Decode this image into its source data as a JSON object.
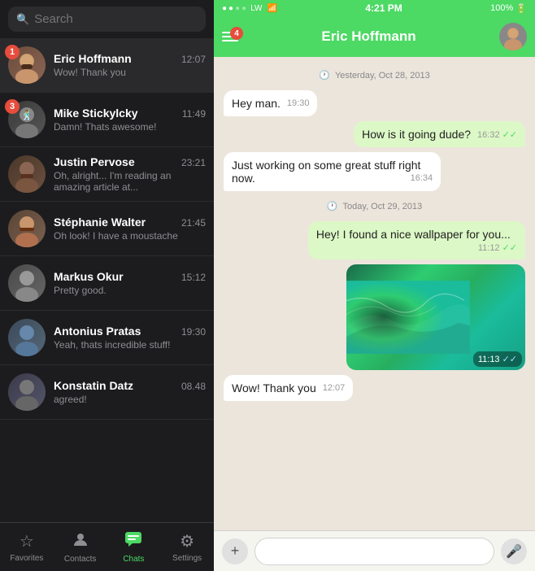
{
  "statusBar": {
    "carrier": "LW",
    "time": "4:21 PM",
    "battery": "100%",
    "signal": "●●○○"
  },
  "searchBar": {
    "placeholder": "Search"
  },
  "chats": [
    {
      "id": "eric",
      "name": "Eric Hoffmann",
      "time": "12:07",
      "preview": "Wow! Thank you",
      "badge": 1,
      "avatarClass": "av-eric",
      "avatarEmoji": "👤",
      "active": true
    },
    {
      "id": "mike",
      "name": "Mike Stickylcky",
      "time": "11:49",
      "preview": "Damn! Thats awesome!",
      "badge": 3,
      "avatarClass": "av-mike",
      "avatarEmoji": "👤"
    },
    {
      "id": "justin",
      "name": "Justin Pervose",
      "time": "23:21",
      "preview": "Oh, alright... I'm reading an amazing article at...",
      "badge": 0,
      "avatarClass": "av-justin",
      "avatarEmoji": "👤"
    },
    {
      "id": "stephanie",
      "name": "Stéphanie Walter",
      "time": "21:45",
      "preview": "Oh look! I have a moustache",
      "badge": 0,
      "avatarClass": "av-stephanie",
      "avatarEmoji": "👤"
    },
    {
      "id": "markus",
      "name": "Markus Okur",
      "time": "15:12",
      "preview": "Pretty good.",
      "badge": 0,
      "avatarClass": "av-markus",
      "avatarEmoji": "👤"
    },
    {
      "id": "antonius",
      "name": "Antonius Pratas",
      "time": "19:30",
      "preview": "Yeah, thats incredible stuff!",
      "badge": 0,
      "avatarClass": "av-antonius",
      "avatarEmoji": "👤"
    },
    {
      "id": "konstatin",
      "name": "Konstatin Datz",
      "time": "08.48",
      "preview": "agreed!",
      "badge": 0,
      "avatarClass": "av-konstatin",
      "avatarEmoji": "👤"
    }
  ],
  "tabBar": {
    "items": [
      {
        "id": "favorites",
        "label": "Favorites",
        "icon": "☆"
      },
      {
        "id": "contacts",
        "label": "Contacts",
        "icon": "👤"
      },
      {
        "id": "chats",
        "label": "Chats",
        "icon": "💬",
        "active": true
      },
      {
        "id": "settings",
        "label": "Settings",
        "icon": "⚙"
      }
    ]
  },
  "chatHeader": {
    "title": "Eric Hoffmann",
    "badgeCount": "4"
  },
  "messages": [
    {
      "type": "date",
      "text": "Yesterday, Oct 28, 2013"
    },
    {
      "type": "incoming",
      "text": "Hey man.",
      "time": "19:30"
    },
    {
      "type": "outgoing",
      "text": "How is it going dude?",
      "time": "16:32",
      "ticks": "✓✓"
    },
    {
      "type": "incoming",
      "text": "Just working on some great stuff right now.",
      "time": "16:34"
    },
    {
      "type": "date",
      "text": "Today, Oct 29, 2013"
    },
    {
      "type": "outgoing",
      "text": "Hey! I found a nice wallpaper for you...",
      "time": "11:12",
      "ticks": "✓✓"
    },
    {
      "type": "image",
      "time": "11:13",
      "ticks": "✓✓"
    },
    {
      "type": "incoming",
      "text": "Wow! Thank you",
      "time": "12:07"
    }
  ],
  "inputBar": {
    "placeholder": "",
    "addLabel": "+",
    "micLabel": "🎤"
  }
}
